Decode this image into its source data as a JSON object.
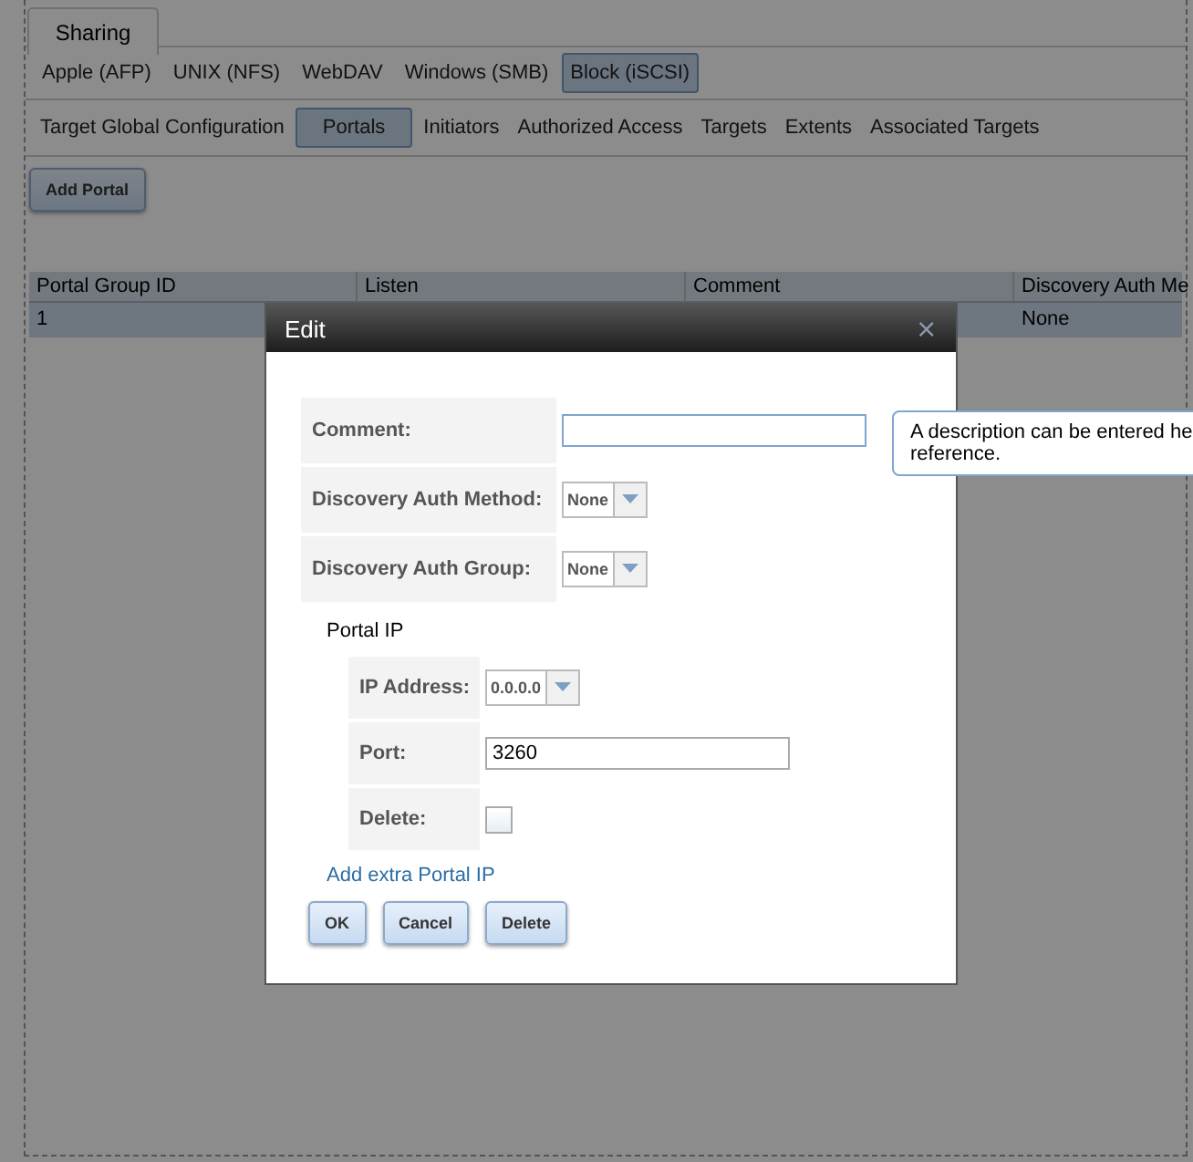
{
  "main_tab": "Sharing",
  "share_tabs": [
    {
      "label": "Apple (AFP)",
      "selected": false
    },
    {
      "label": "UNIX (NFS)",
      "selected": false
    },
    {
      "label": "WebDAV",
      "selected": false
    },
    {
      "label": "Windows (SMB)",
      "selected": false
    },
    {
      "label": "Block (iSCSI)",
      "selected": true
    }
  ],
  "iscsi_tabs": [
    {
      "label": "Target Global Configuration",
      "selected": false
    },
    {
      "label": "Portals",
      "selected": true
    },
    {
      "label": "Initiators",
      "selected": false
    },
    {
      "label": "Authorized Access",
      "selected": false
    },
    {
      "label": "Targets",
      "selected": false
    },
    {
      "label": "Extents",
      "selected": false
    },
    {
      "label": "Associated Targets",
      "selected": false
    }
  ],
  "add_button": "Add Portal",
  "table": {
    "columns": [
      "Portal Group ID",
      "Listen",
      "Comment",
      "Discovery Auth Me"
    ],
    "rows": [
      [
        "1",
        "",
        "",
        "None"
      ]
    ]
  },
  "dialog": {
    "title": "Edit",
    "close": "⨯",
    "fields": [
      {
        "kind": "text",
        "label": "Comment:"
      },
      {
        "kind": "select",
        "label": "Discovery Auth Method:",
        "value": "None"
      },
      {
        "kind": "select",
        "label": "Discovery Auth Group:",
        "value": "None"
      }
    ],
    "tooltip": {
      "lines": [
        "A description can be entered he",
        "reference."
      ]
    },
    "section": "Portal IP",
    "ip_fields": [
      {
        "kind": "select",
        "label": "IP Address:",
        "value": "0.0.0.0"
      },
      {
        "kind": "text",
        "label": "Port:",
        "value": "3260"
      },
      {
        "kind": "checkbox",
        "label": "Delete:",
        "checked": false
      }
    ],
    "add_link": "Add extra Portal IP",
    "buttons": [
      "OK",
      "Cancel",
      "Delete"
    ]
  }
}
